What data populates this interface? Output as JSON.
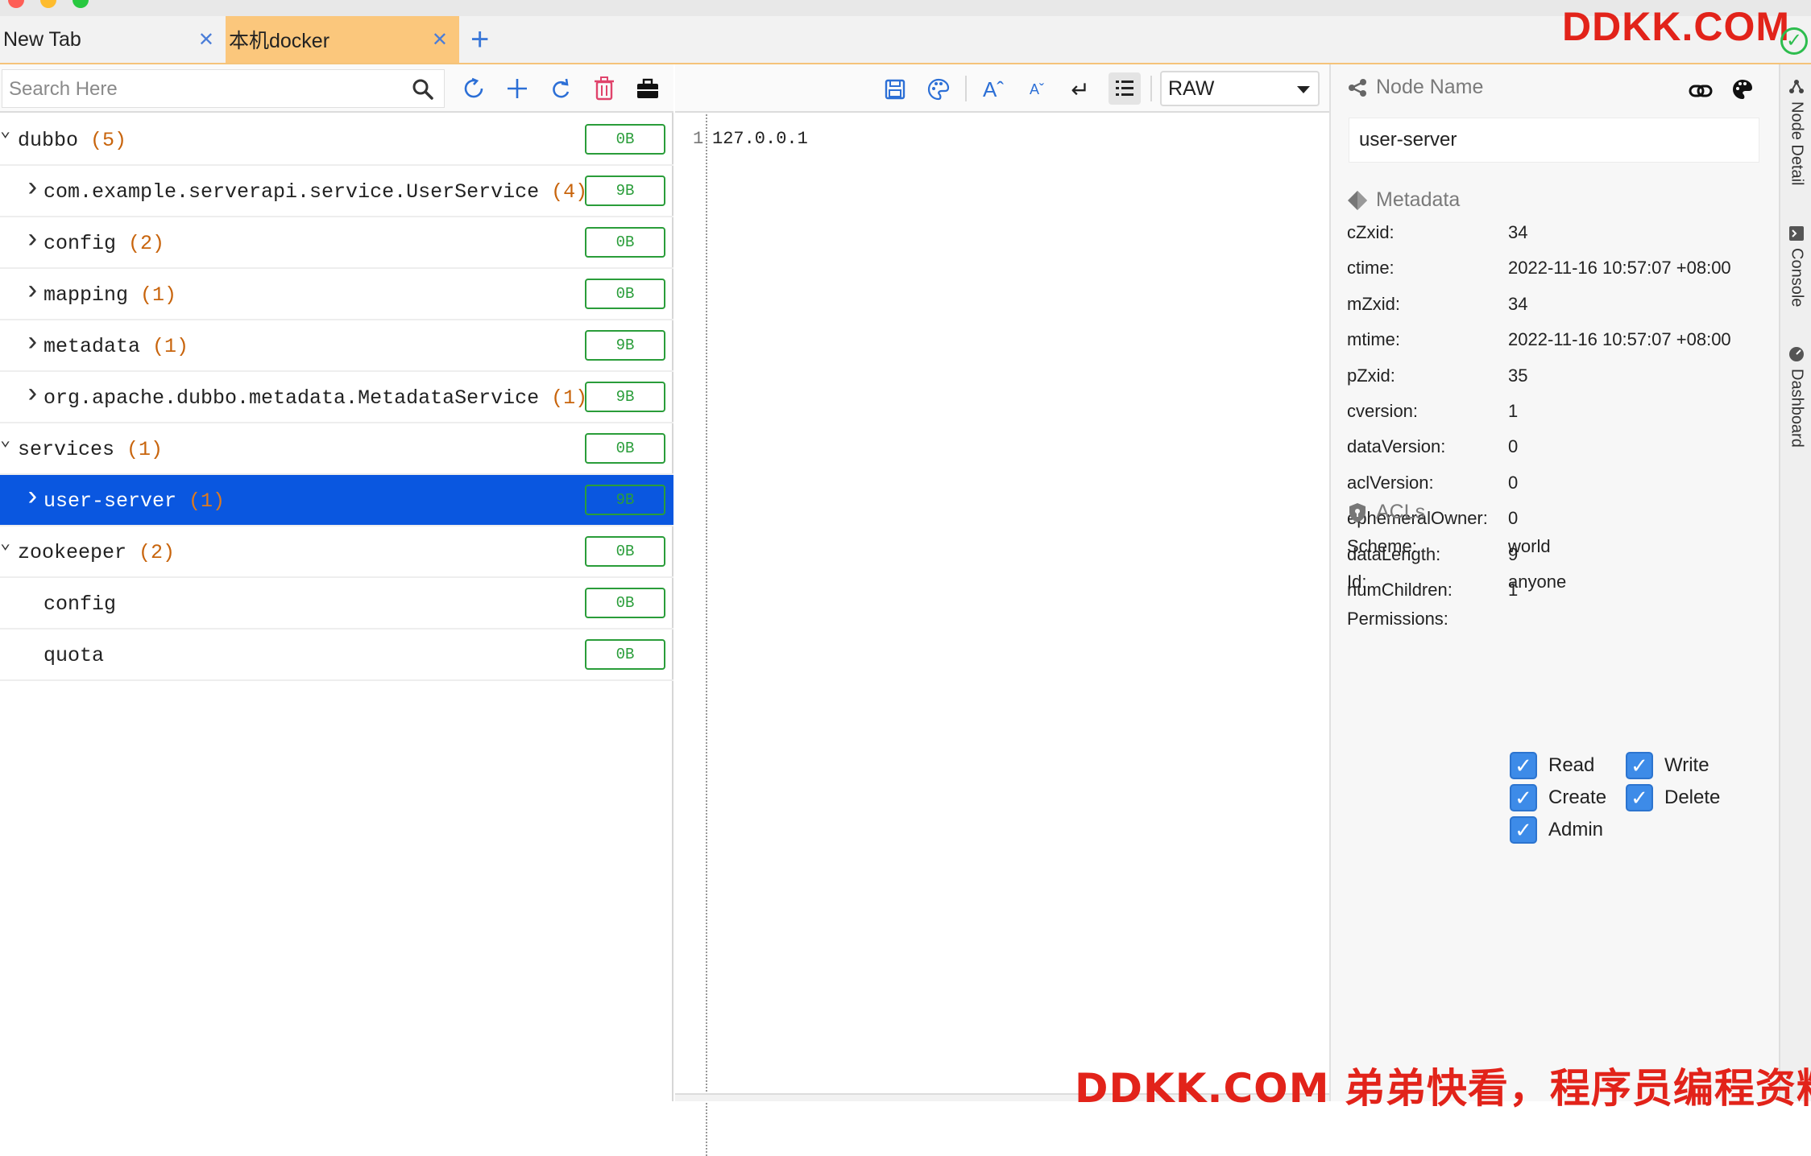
{
  "tabs": [
    {
      "label": "New Tab",
      "active": false
    },
    {
      "label": "本机docker",
      "active": true
    }
  ],
  "watermark_top": "DDKK.COM",
  "watermark_bottom": "DDKK.COM 弟弟快看，程序员编程资料站",
  "search": {
    "placeholder": "Search Here",
    "value": ""
  },
  "tree": [
    {
      "indent": 0,
      "caret": "expanded",
      "name": "dubbo",
      "count": "(5)",
      "size": "0B",
      "selected": false
    },
    {
      "indent": 1,
      "caret": "collapsed",
      "name": "com.example.serverapi.service.UserService",
      "count": "(4)",
      "size": "9B",
      "selected": false
    },
    {
      "indent": 1,
      "caret": "collapsed",
      "name": "config",
      "count": "(2)",
      "size": "0B",
      "selected": false
    },
    {
      "indent": 1,
      "caret": "collapsed",
      "name": "mapping",
      "count": "(1)",
      "size": "0B",
      "selected": false
    },
    {
      "indent": 1,
      "caret": "collapsed",
      "name": "metadata",
      "count": "(1)",
      "size": "9B",
      "selected": false
    },
    {
      "indent": 1,
      "caret": "collapsed",
      "name": "org.apache.dubbo.metadata.MetadataService",
      "count": "(1)",
      "size": "9B",
      "selected": false
    },
    {
      "indent": 0,
      "caret": "expanded",
      "name": "services",
      "count": "(1)",
      "size": "0B",
      "selected": false
    },
    {
      "indent": 1,
      "caret": "collapsed",
      "name": "user-server",
      "count": "(1)",
      "size": "9B",
      "selected": true
    },
    {
      "indent": 0,
      "caret": "expanded",
      "name": "zookeeper",
      "count": "(2)",
      "size": "0B",
      "selected": false
    },
    {
      "indent": 1,
      "caret": "none",
      "name": "config",
      "count": "",
      "size": "0B",
      "selected": false
    },
    {
      "indent": 1,
      "caret": "none",
      "name": "quota",
      "count": "",
      "size": "0B",
      "selected": false
    }
  ],
  "editor": {
    "format": "RAW",
    "line_number": "1",
    "content": "127.0.0.1"
  },
  "detail": {
    "node_name_heading": "Node Name",
    "node_name": "user-server",
    "metadata_heading": "Metadata",
    "metadata": [
      {
        "key": "cZxid:",
        "value": "34"
      },
      {
        "key": "ctime:",
        "value": "2022-11-16 10:57:07 +08:00"
      },
      {
        "key": "mZxid:",
        "value": "34"
      },
      {
        "key": "mtime:",
        "value": "2022-11-16 10:57:07 +08:00"
      },
      {
        "key": "pZxid:",
        "value": "35"
      },
      {
        "key": "cversion:",
        "value": "1"
      },
      {
        "key": "dataVersion:",
        "value": "0"
      },
      {
        "key": "aclVersion:",
        "value": "0"
      },
      {
        "key": "ephemeralOwner:",
        "value": "0"
      },
      {
        "key": "dataLength:",
        "value": "9"
      },
      {
        "key": "numChildren:",
        "value": "1"
      }
    ],
    "acls_heading": "ACLs",
    "scheme_label": "Scheme:",
    "scheme_value": "world",
    "id_label": "Id:",
    "id_value": "anyone",
    "permissions_label": "Permissions:",
    "permissions": [
      {
        "label": "Read",
        "checked": true
      },
      {
        "label": "Write",
        "checked": true
      },
      {
        "label": "Create",
        "checked": true
      },
      {
        "label": "Delete",
        "checked": true
      },
      {
        "label": "Admin",
        "checked": true
      }
    ]
  },
  "side_tabs": [
    "Node Detail",
    "Console",
    "Dashboard"
  ],
  "colors": {
    "selected_row": "#0a57e0",
    "active_tab": "#fbc77c",
    "count_text": "#c8640c",
    "size_badge": "#2a9d3a",
    "accent_blue": "#2c6fd6",
    "delete_icon": "#e0436b",
    "watermark": "#e2231a"
  }
}
